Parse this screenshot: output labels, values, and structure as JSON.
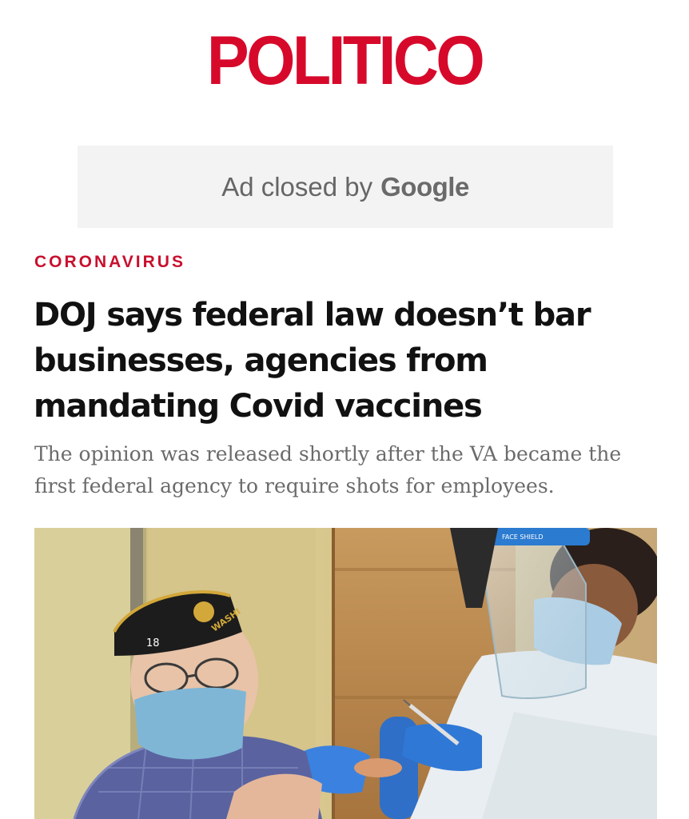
{
  "header": {
    "logo": "POLITICO"
  },
  "ad": {
    "prefix": "Ad closed by",
    "brand": "Google"
  },
  "article": {
    "section": "CORONAVIRUS",
    "headline": "DOJ says federal law doesn’t bar businesses, agencies from mandating Covid vaccines",
    "dek": "The opinion was released shortly after the VA became the first federal agency to require shots for employees.",
    "photo": {
      "description": "elderly veteran receiving a Covid vaccine from a health worker in a face shield",
      "cap_text": "WASHI",
      "cap_number": "18",
      "shield_text": "FACE SHIELD"
    }
  },
  "colors": {
    "brand": "#d7092b",
    "section": "#c8102e",
    "headline": "#111111",
    "dek": "#6b6b6b"
  }
}
